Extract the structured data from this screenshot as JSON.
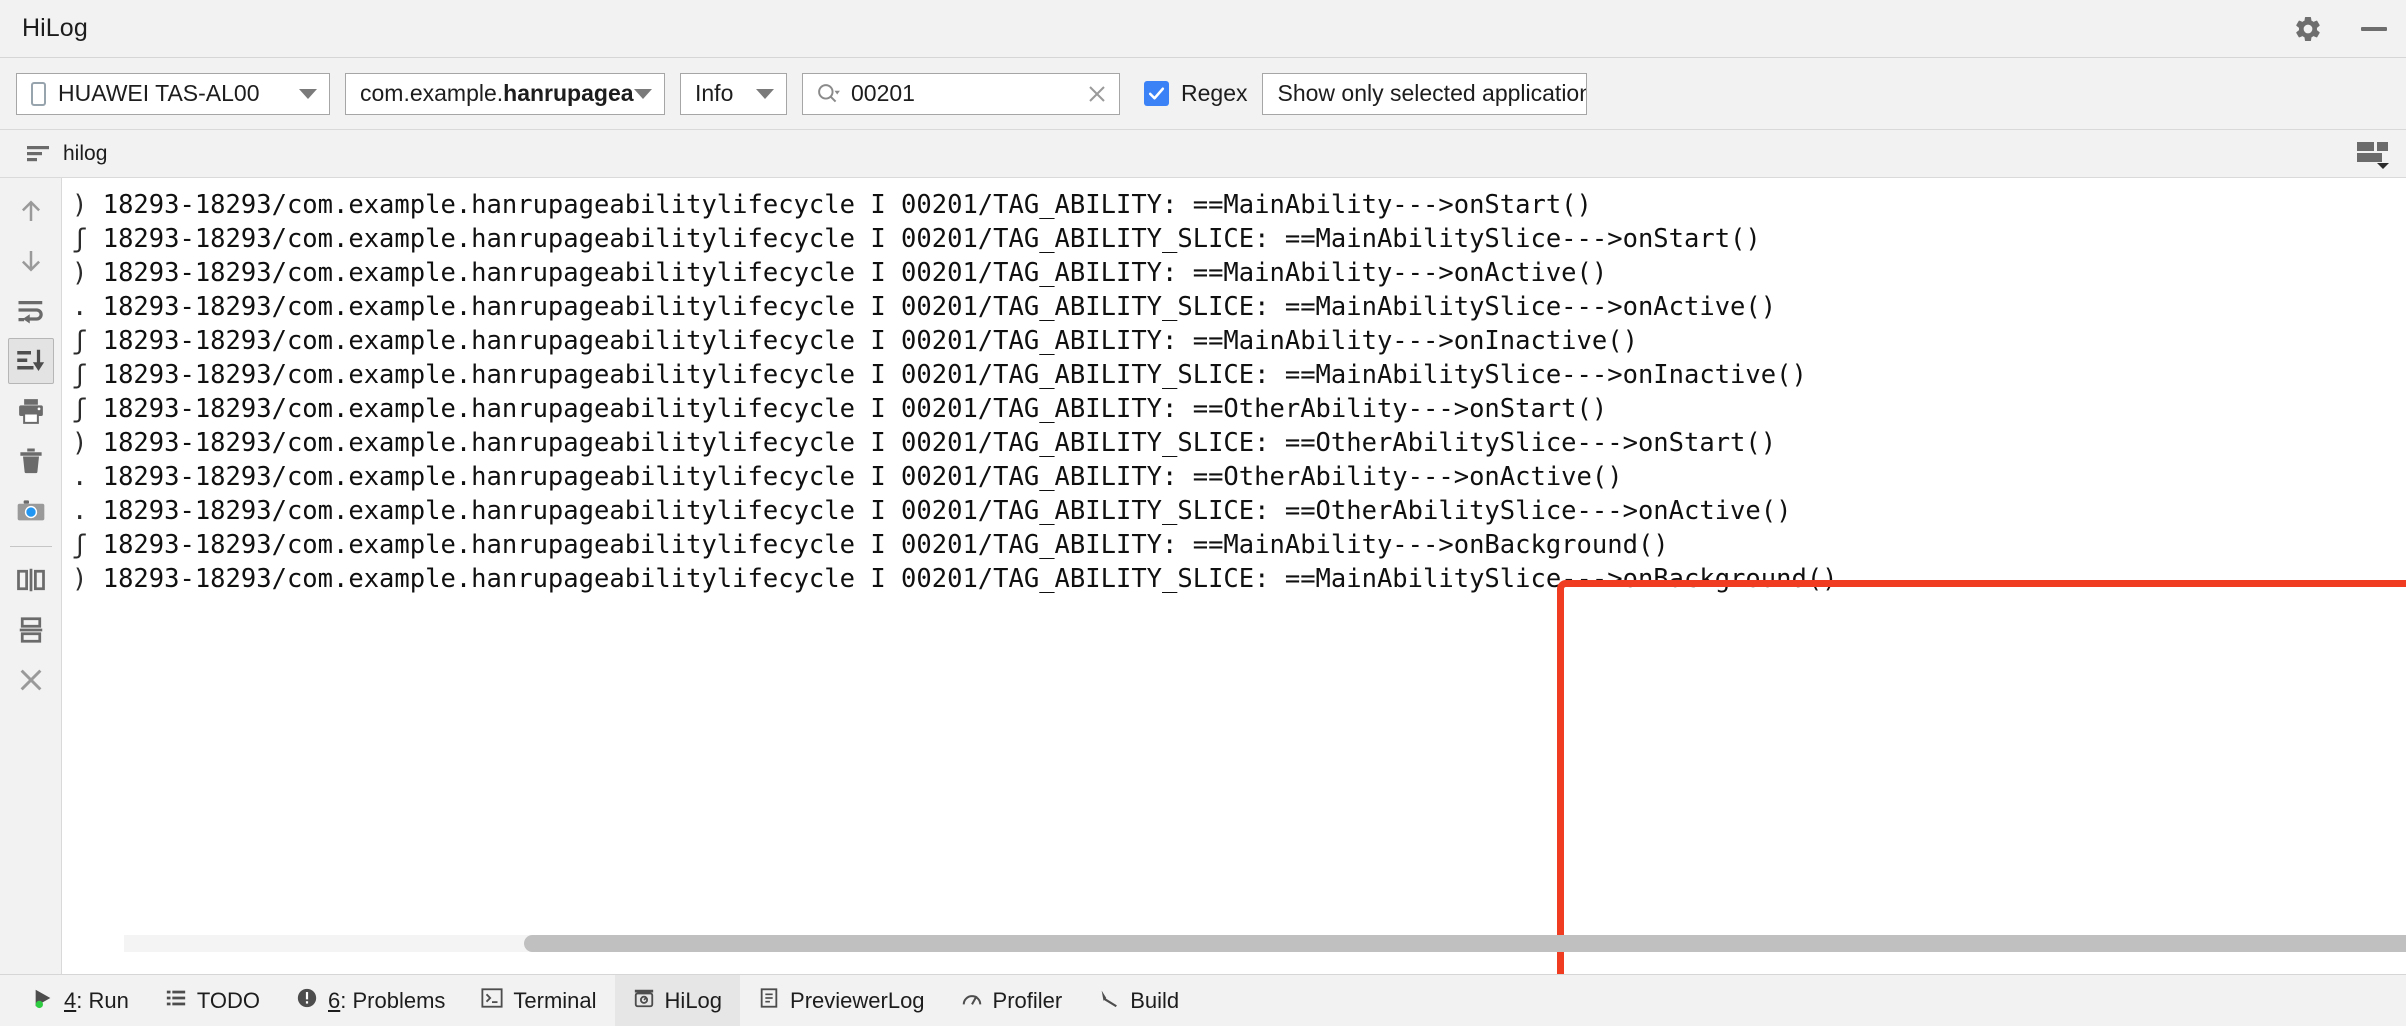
{
  "window": {
    "title": "HiLog",
    "settings_icon": "gear-icon",
    "minimize_icon": "minimize-icon"
  },
  "toolbar": {
    "device": {
      "icon": "phone-icon",
      "value": "HUAWEI TAS-AL00",
      "caret": "chevron-down-icon"
    },
    "package": {
      "prefix": "com.example.",
      "bold": "hanrupageabilitylif",
      "value": "com.example.hanrupageabilitylif"
    },
    "level": {
      "value": "Info"
    },
    "search": {
      "icon": "search-icon",
      "value": "00201",
      "placeholder": "",
      "clear_icon": "close-icon"
    },
    "regex": {
      "label": "Regex",
      "checked": true,
      "check_glyph": "✓",
      "accent": "#3b82f6"
    },
    "scope": {
      "value": "Show only selected application"
    }
  },
  "tabstrip": {
    "tab_label": "hilog",
    "tab_icon": "log-lines-icon",
    "layout_icon": "view-layout-icon"
  },
  "sidebar": {
    "items": [
      {
        "name": "scroll-up-icon",
        "label": "Up",
        "active": false
      },
      {
        "name": "scroll-down-icon",
        "label": "Down",
        "active": false
      },
      {
        "name": "soft-wrap-icon",
        "label": "Soft-Wrap",
        "active": false
      },
      {
        "name": "scroll-to-end-icon",
        "label": "Scroll to End",
        "active": true
      },
      {
        "name": "print-icon",
        "label": "Print",
        "active": false
      },
      {
        "name": "trash-icon",
        "label": "Clear",
        "active": false
      },
      {
        "name": "camera-icon",
        "label": "Screenshot",
        "active": false
      },
      {
        "name": "split-vertical-icon",
        "label": "Split Vertically",
        "active": false
      },
      {
        "name": "split-horizontal-icon",
        "label": "Split Horizontally",
        "active": false
      },
      {
        "name": "close-icon",
        "label": "Close",
        "active": false
      }
    ]
  },
  "log": {
    "lines": [
      {
        "gutter": ")",
        "text": "18293-18293/com.example.hanrupageabilitylifecycle I 00201/TAG_ABILITY: ==MainAbility--->onStart()"
      },
      {
        "gutter": "ʃ",
        "text": "18293-18293/com.example.hanrupageabilitylifecycle I 00201/TAG_ABILITY_SLICE: ==MainAbilitySlice--->onStart()"
      },
      {
        "gutter": ")",
        "text": "18293-18293/com.example.hanrupageabilitylifecycle I 00201/TAG_ABILITY: ==MainAbility--->onActive()"
      },
      {
        "gutter": ".",
        "text": "18293-18293/com.example.hanrupageabilitylifecycle I 00201/TAG_ABILITY_SLICE: ==MainAbilitySlice--->onActive()"
      },
      {
        "gutter": "ʃ",
        "text": "18293-18293/com.example.hanrupageabilitylifecycle I 00201/TAG_ABILITY: ==MainAbility--->onInactive()"
      },
      {
        "gutter": "ʃ",
        "text": "18293-18293/com.example.hanrupageabilitylifecycle I 00201/TAG_ABILITY_SLICE: ==MainAbilitySlice--->onInactive()"
      },
      {
        "gutter": "ʃ",
        "text": "18293-18293/com.example.hanrupageabilitylifecycle I 00201/TAG_ABILITY: ==OtherAbility--->onStart()"
      },
      {
        "gutter": ")",
        "text": "18293-18293/com.example.hanrupageabilitylifecycle I 00201/TAG_ABILITY_SLICE: ==OtherAbilitySlice--->onStart()"
      },
      {
        "gutter": ".",
        "text": "18293-18293/com.example.hanrupageabilitylifecycle I 00201/TAG_ABILITY: ==OtherAbility--->onActive()"
      },
      {
        "gutter": ".",
        "text": "18293-18293/com.example.hanrupageabilitylifecycle I 00201/TAG_ABILITY_SLICE: ==OtherAbilitySlice--->onActive()"
      },
      {
        "gutter": "ʃ",
        "text": "18293-18293/com.example.hanrupageabilitylifecycle I 00201/TAG_ABILITY: ==MainAbility--->onBackground()"
      },
      {
        "gutter": ")",
        "text": "18293-18293/com.example.hanrupageabilitylifecycle I 00201/TAG_ABILITY_SLICE: ==MainAbilitySlice--->onBackground()"
      }
    ],
    "highlight": {
      "color": "#f03c20",
      "note": "red annotation rectangle around last 8 log message bodies"
    }
  },
  "statusbar": {
    "items": [
      {
        "icon": "run-icon",
        "num": "4",
        "label": ": Run",
        "active": false
      },
      {
        "icon": "todo-icon",
        "num": "",
        "label": "TODO",
        "active": false
      },
      {
        "icon": "problems-icon",
        "num": "6",
        "label": ": Problems",
        "active": false
      },
      {
        "icon": "terminal-icon",
        "num": "",
        "label": "Terminal",
        "active": false
      },
      {
        "icon": "hilog-icon",
        "num": "",
        "label": "HiLog",
        "active": true
      },
      {
        "icon": "previewerlog-icon",
        "num": "",
        "label": "PreviewerLog",
        "active": false
      },
      {
        "icon": "profiler-icon",
        "num": "",
        "label": "Profiler",
        "active": false
      },
      {
        "icon": "build-icon",
        "num": "",
        "label": "Build",
        "active": false
      }
    ]
  }
}
